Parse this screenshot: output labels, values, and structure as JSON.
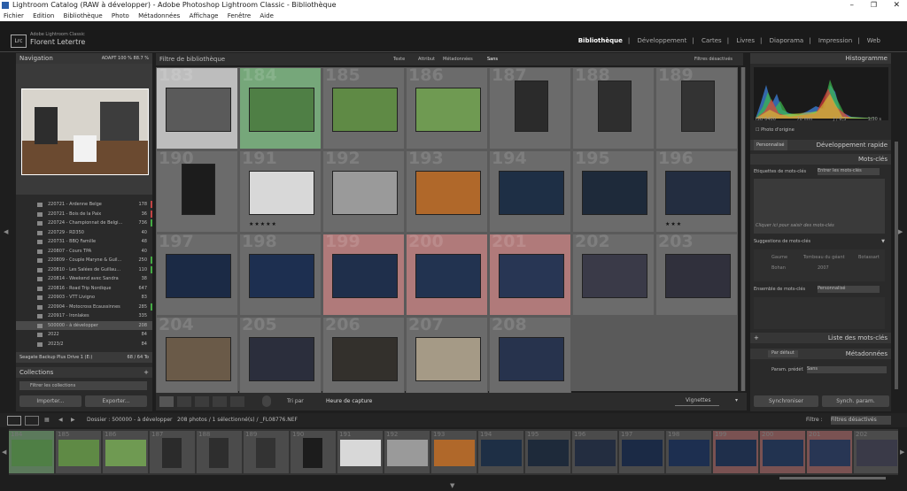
{
  "window": {
    "title": "Lightroom Catalog (RAW à développer) - Adobe Photoshop Lightroom Classic - Bibliothèque"
  },
  "menu": [
    "Fichier",
    "Edition",
    "Bibliothèque",
    "Photo",
    "Métadonnées",
    "Affichage",
    "Fenêtre",
    "Aide"
  ],
  "identity": {
    "product": "Adobe Lightroom Classic",
    "user": "Florent Letertre",
    "badge": "Lrc"
  },
  "modules": [
    "Bibliothèque",
    "Développement",
    "Cartes",
    "Livres",
    "Diaporama",
    "Impression",
    "Web"
  ],
  "navigator": {
    "title": "Navigation",
    "zoom": [
      "ADAPT",
      "100 %",
      "88.7 %"
    ]
  },
  "folders": [
    {
      "name": "220721 - Ardenne Belge",
      "count": "178",
      "flag": "red"
    },
    {
      "name": "220721 - Bois de la Paix",
      "count": "36",
      "flag": "red"
    },
    {
      "name": "220724 - Championnat de Belgi...",
      "count": "736",
      "flag": "green"
    },
    {
      "name": "220729 - RD350",
      "count": "40",
      "flag": ""
    },
    {
      "name": "220731 - BBQ Famille",
      "count": "48",
      "flag": ""
    },
    {
      "name": "220807 - Cours TPA",
      "count": "40",
      "flag": ""
    },
    {
      "name": "220809 - Couple Maryne & Guil...",
      "count": "250",
      "flag": "green"
    },
    {
      "name": "220810 - Les Salées de Guillau...",
      "count": "110",
      "flag": "green"
    },
    {
      "name": "220814 - Weekend avec Sandra",
      "count": "38",
      "flag": ""
    },
    {
      "name": "220816 - Road Trip Nordique",
      "count": "647",
      "flag": ""
    },
    {
      "name": "220903 - VTT Livigno",
      "count": "83",
      "flag": ""
    },
    {
      "name": "220904 - Motocross Ecaussinnes",
      "count": "285",
      "flag": "green"
    },
    {
      "name": "220917 - Ironlakes",
      "count": "335",
      "flag": ""
    },
    {
      "name": "500000 - à développer",
      "count": "208",
      "flag": ""
    },
    {
      "name": "2022",
      "count": "84",
      "flag": ""
    },
    {
      "name": "2023/2",
      "count": "84",
      "flag": ""
    }
  ],
  "volume": {
    "name": "Seagate Backup Plus Drive 1 (E:)",
    "size": "68 / 64 To"
  },
  "collections": {
    "title": "Collections",
    "filter": "Filtrer les collections"
  },
  "buttons": {
    "import": "Importer...",
    "export": "Exporter...",
    "sync": "Synchroniser",
    "sync_settings": "Synch. param."
  },
  "filterbar": {
    "title": "Filtre de bibliothèque",
    "tabs": [
      "Texte",
      "Attribut",
      "Métadonnées",
      "Sans"
    ],
    "status": "Filtres désactivés"
  },
  "grid": [
    {
      "n": "183",
      "bg": "#bdbdbd",
      "img": "#5a5a5a",
      "stars": ""
    },
    {
      "n": "184",
      "bg": "#76a77a",
      "img": "#4f7f45",
      "stars": ""
    },
    {
      "n": "185",
      "bg": "#6b6b6b",
      "img": "#5f8a45",
      "stars": ""
    },
    {
      "n": "186",
      "bg": "#6b6b6b",
      "img": "#6f9a52",
      "stars": ""
    },
    {
      "n": "187",
      "bg": "#6b6b6b",
      "img": "#2b2b2b",
      "stars": ""
    },
    {
      "n": "188",
      "bg": "#6b6b6b",
      "img": "#2e2e2e",
      "stars": ""
    },
    {
      "n": "189",
      "bg": "#6b6b6b",
      "img": "#333333",
      "stars": ""
    },
    {
      "n": "190",
      "bg": "#6b6b6b",
      "img": "#1c1c1c",
      "stars": ""
    },
    {
      "n": "191",
      "bg": "#6b6b6b",
      "img": "#d8d8d8",
      "stars": "★★★★★"
    },
    {
      "n": "192",
      "bg": "#6b6b6b",
      "img": "#9a9a9a",
      "stars": ""
    },
    {
      "n": "193",
      "bg": "#6b6b6b",
      "img": "#b0682a",
      "stars": ""
    },
    {
      "n": "194",
      "bg": "#6b6b6b",
      "img": "#1e2f45",
      "stars": ""
    },
    {
      "n": "195",
      "bg": "#6b6b6b",
      "img": "#1e2a3a",
      "stars": ""
    },
    {
      "n": "196",
      "bg": "#6b6b6b",
      "img": "#232d40",
      "stars": "★★★"
    },
    {
      "n": "197",
      "bg": "#6b6b6b",
      "img": "#1b2a45",
      "stars": ""
    },
    {
      "n": "198",
      "bg": "#6b6b6b",
      "img": "#1d2f50",
      "stars": ""
    },
    {
      "n": "199",
      "bg": "#b07a7a",
      "img": "#1f2f4b",
      "stars": ""
    },
    {
      "n": "200",
      "bg": "#b07a7a",
      "img": "#223350",
      "stars": ""
    },
    {
      "n": "201",
      "bg": "#b07a7a",
      "img": "#283654",
      "stars": ""
    },
    {
      "n": "202",
      "bg": "#6b6b6b",
      "img": "#3a3a48",
      "stars": ""
    },
    {
      "n": "203",
      "bg": "#6b6b6b",
      "img": "#30303c",
      "stars": ""
    },
    {
      "n": "204",
      "bg": "#6b6b6b",
      "img": "#6a5a48",
      "stars": ""
    },
    {
      "n": "205",
      "bg": "#6b6b6b",
      "img": "#2b2e3c",
      "stars": ""
    },
    {
      "n": "206",
      "bg": "#6b6b6b",
      "img": "#33302c",
      "stars": ""
    },
    {
      "n": "207",
      "bg": "#6b6b6b",
      "img": "#a59a86",
      "stars": ""
    },
    {
      "n": "208",
      "bg": "#6b6b6b",
      "img": "#27334d",
      "stars": ""
    }
  ],
  "toolbar": {
    "sort_label": "Tri par",
    "sort_value": "Heure de capture",
    "thumb_label": "Vignettes"
  },
  "filmstrip": {
    "source": "Dossier : 500000 - à développer",
    "info": "208 photos / 1 sélectionné(s) / _FL08776.NEF",
    "filter_label": "Filtre :",
    "filter_value": "Filtres désactivés",
    "cells": [
      {
        "n": "184",
        "img": "#4f7f45"
      },
      {
        "n": "185",
        "img": "#5f8a45"
      },
      {
        "n": "186",
        "img": "#6f9a52"
      },
      {
        "n": "187",
        "img": "#2b2b2b"
      },
      {
        "n": "188",
        "img": "#2e2e2e"
      },
      {
        "n": "189",
        "img": "#333333"
      },
      {
        "n": "190",
        "img": "#1c1c1c"
      },
      {
        "n": "191",
        "img": "#d8d8d8"
      },
      {
        "n": "192",
        "img": "#9a9a9a"
      },
      {
        "n": "193",
        "img": "#b0682a"
      },
      {
        "n": "194",
        "img": "#1e2f45"
      },
      {
        "n": "195",
        "img": "#1e2a3a"
      },
      {
        "n": "196",
        "img": "#232d40"
      },
      {
        "n": "197",
        "img": "#1b2a45"
      },
      {
        "n": "198",
        "img": "#1d2f50"
      },
      {
        "n": "199",
        "img": "#1f2f4b"
      },
      {
        "n": "200",
        "img": "#223350"
      },
      {
        "n": "201",
        "img": "#283654"
      },
      {
        "n": "202",
        "img": "#3a3a48"
      }
    ]
  },
  "right": {
    "histogram": "Histogramme",
    "exif": [
      "ISO 6400",
      "70 mm",
      "ƒ / 6,3",
      "1/30 s"
    ],
    "original": "Photo d'origine",
    "quick_develop": "Développement rapide",
    "quick_preset": "Personnalisé",
    "keywords": "Mots-clés",
    "kw_tags": "Etiquettes de mots-clés",
    "kw_enter": "Entrer les mots-clés",
    "kw_click": "Cliquer ici pour saisir des mots-clés",
    "kw_suggest": "Suggestions de mots-clés",
    "kw_suggest_items": [
      "Gaume",
      "Tombeau du géant",
      "Botassart",
      "Bohan",
      "2007"
    ],
    "kw_set": "Ensemble de mots-clés",
    "kw_set_value": "Personnalisé",
    "kw_list": "Liste des mots-clés",
    "metadata": "Métadonnées",
    "meta_mode": "Par défaut",
    "meta_preset_label": "Param. prédéf.",
    "meta_preset_value": "Sans"
  }
}
